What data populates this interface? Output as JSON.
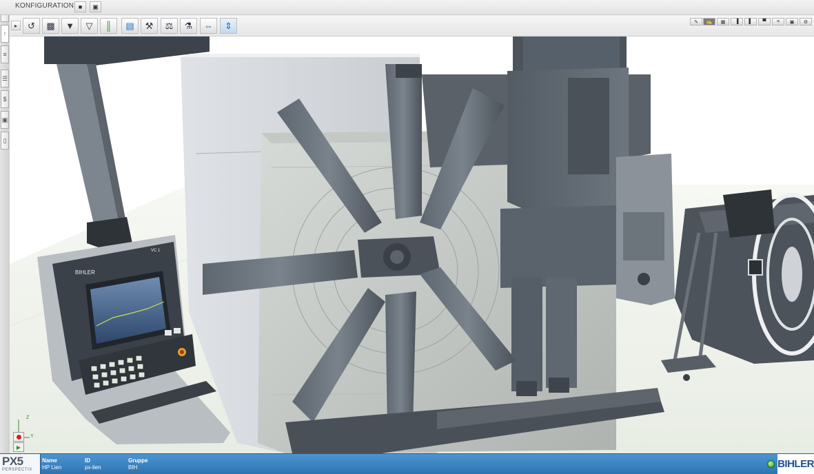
{
  "header": {
    "title": "KONFIGURATION",
    "save_icon": "save-icon",
    "window_icon": "window-icon"
  },
  "sidebar": {
    "tabs": [
      "info-icon",
      "chart-icon",
      "document-icon",
      "notes-icon",
      "dollar-icon",
      "machine-icon",
      "copy-icon"
    ],
    "tab_glyphs": [
      "i",
      "↑",
      "≡",
      "☰",
      "$",
      "▣",
      "▯"
    ]
  },
  "toolbar": {
    "tools": [
      {
        "name": "play-icon",
        "glyph": "▸"
      },
      {
        "name": "rotate-icon",
        "glyph": "↺"
      },
      {
        "name": "camera-view-icon",
        "glyph": "▩"
      },
      {
        "name": "tool-unit-icon",
        "glyph": "▼"
      },
      {
        "name": "tool-unit-alt-icon",
        "glyph": "▽"
      },
      {
        "name": "rail-icon",
        "glyph": "║"
      },
      {
        "name": "module-icon",
        "glyph": "▤"
      },
      {
        "name": "screw-icon",
        "glyph": "⚒"
      },
      {
        "name": "arm-icon",
        "glyph": "⚖"
      },
      {
        "name": "gripper-icon",
        "glyph": "⚗"
      },
      {
        "name": "move-horizontal-icon",
        "glyph": "⇔"
      },
      {
        "name": "move-vertical-icon",
        "glyph": "⇕"
      }
    ],
    "view_tools": [
      {
        "name": "pencil-icon",
        "glyph": "✎"
      },
      {
        "name": "draw-icon",
        "glyph": "✍"
      },
      {
        "name": "grid-icon",
        "glyph": "▦"
      },
      {
        "name": "align-left-icon",
        "glyph": "▐"
      },
      {
        "name": "align-right-icon",
        "glyph": "▌"
      },
      {
        "name": "align-top-icon",
        "glyph": "▀"
      },
      {
        "name": "align-middle-icon",
        "glyph": "≡"
      },
      {
        "name": "layout-icon",
        "glyph": "▣"
      },
      {
        "name": "settings-icon",
        "glyph": "⚙"
      }
    ]
  },
  "viewport": {
    "panel_brand": "BIHLER",
    "panel_label": "VC 1",
    "axis_z": "Z",
    "axis_y": "Y"
  },
  "status": {
    "columns": [
      {
        "header": "Name",
        "value": "HP Lien"
      },
      {
        "header": "ID",
        "value": "px-lien"
      },
      {
        "header": "Gruppe",
        "value": "BIH"
      }
    ],
    "product": "PX5",
    "product_sub": "PERSPECTIX",
    "brand": "BIHLER"
  },
  "colors": {
    "status_bar": "#3a82c2",
    "machine_dark": "#4a525b",
    "machine_light": "#c9cdd1",
    "floor": "#eef2ea"
  }
}
